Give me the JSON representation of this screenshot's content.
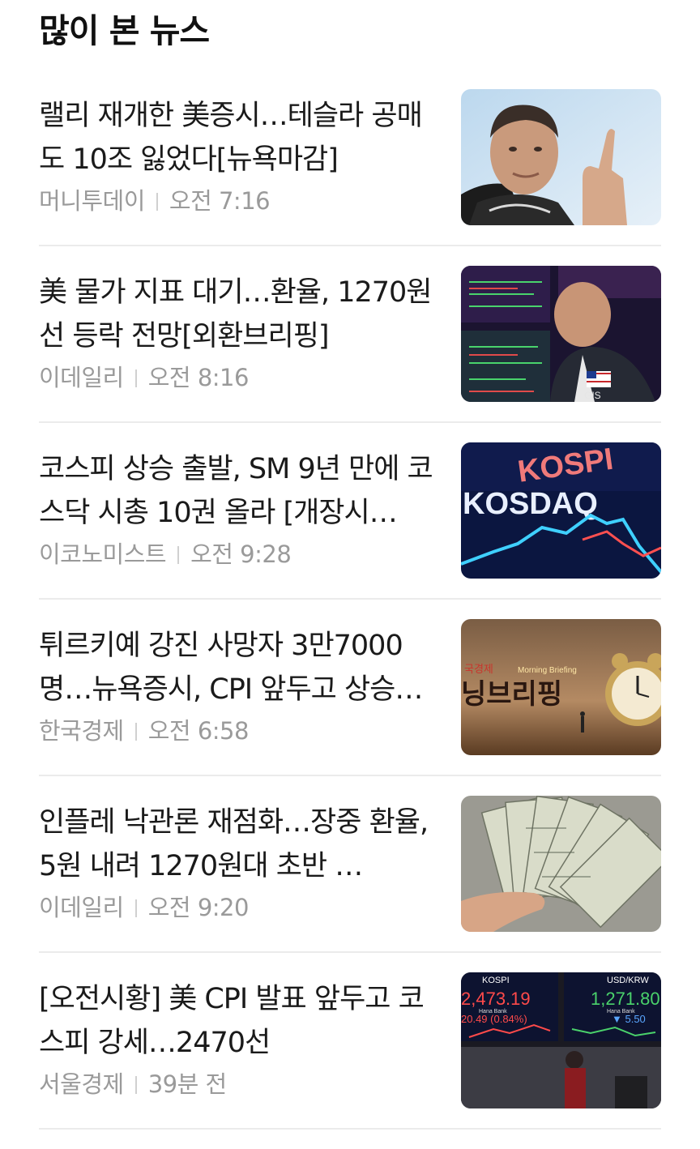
{
  "section": {
    "title": "많이 본 뉴스"
  },
  "articles": [
    {
      "headline": "랠리 재개한 美증시…테슬라 공매도 10조 잃었다[뉴욕마감]",
      "source": "머니투데이",
      "time": "오전 7:16",
      "thumbnail": "photo-man-pointing"
    },
    {
      "headline": "美 물가 지표 대기…환율, 1270원선 등락 전망[외환브리핑]",
      "source": "이데일리",
      "time": "오전 8:16",
      "thumbnail": "photo-trader-screens"
    },
    {
      "headline": "코스피 상승 출발, SM 9년 만에 코스닥 시총 10권 올라 [개장시…",
      "source": "이코노미스트",
      "time": "오전 9:28",
      "thumbnail": "photo-kospi-kosdaq-board"
    },
    {
      "headline": "튀르키예 강진 사망자 3만7000명…뉴욕증시, CPI 앞두고 상승…",
      "source": "한국경제",
      "time": "오전 6:58",
      "thumbnail": "photo-morning-briefing-clock"
    },
    {
      "headline": "인플레 낙관론 재점화…장중 환율, 5원 내려 1270원대 초반 …",
      "source": "이데일리",
      "time": "오전 9:20",
      "thumbnail": "photo-dollar-bills"
    },
    {
      "headline": "[오전시황] 美 CPI 발표 앞두고 코스피 강세…2470선",
      "source": "서울경제",
      "time": "39분 전",
      "thumbnail": "photo-dealing-room"
    }
  ],
  "thumb_text": {
    "kospi": "KOSPI",
    "kosdaq": "KOSDAQ",
    "briefing_en": "Morning Briefing",
    "briefing_ko_top": "국경제",
    "briefing_ko": "닝브리핑",
    "gis": "GIS",
    "board_left_label": "KOSPI",
    "board_left_value": "2,473.19",
    "board_left_change": "20.49  (0.84%)",
    "board_right_label": "USD/KRW",
    "board_right_value": "1,271.80",
    "board_right_change": "▼ 5.50",
    "bank": "Hana Bank"
  }
}
